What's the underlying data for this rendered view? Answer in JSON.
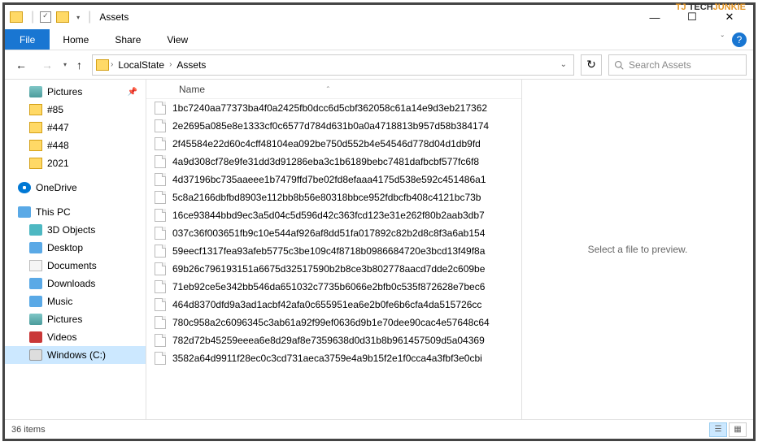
{
  "watermark": {
    "tj": "TJ",
    "tech": "TECH",
    "junkie": "JUNKIE"
  },
  "titlebar": {
    "title": "Assets"
  },
  "menubar": {
    "file": "File",
    "home": "Home",
    "share": "Share",
    "view": "View"
  },
  "breadcrumb": {
    "item1": "LocalState",
    "item2": "Assets"
  },
  "search": {
    "placeholder": "Search Assets"
  },
  "sidebar": {
    "pictures": "Pictures",
    "f85": "#85",
    "f447": "#447",
    "f448": "#448",
    "f2021": "2021",
    "onedrive": "OneDrive",
    "thispc": "This PC",
    "objects3d": "3D Objects",
    "desktop": "Desktop",
    "documents": "Documents",
    "downloads": "Downloads",
    "music": "Music",
    "picslib": "Pictures",
    "videos": "Videos",
    "windowsc": "Windows (C:)"
  },
  "columns": {
    "name": "Name"
  },
  "files": {
    "f0": "1bc7240aa77373ba4f0a2425fb0dcc6d5cbf362058c61a14e9d3eb217362",
    "f1": "2e2695a085e8e1333cf0c6577d784d631b0a0a4718813b957d58b384174",
    "f2": "2f45584e22d60c4cff48104ea092be750d552b4e54546d778d04d1db9fd",
    "f3": "4a9d308cf78e9fe31dd3d91286eba3c1b6189bebc7481dafbcbf577fc6f8",
    "f4": "4d37196bc735aaeee1b7479ffd7be02fd8efaaa4175d538e592c451486a1",
    "f5": "5c8a2166dbfbd8903e112bb8b56e80318bbce952fdbcfb408c4121bc73b",
    "f6": "16ce93844bbd9ec3a5d04c5d596d42c363fcd123e31e262f80b2aab3db7",
    "f7": "037c36f003651fb9c10e544af926af8dd51fa017892c82b2d8c8f3a6ab154",
    "f8": "59eecf1317fea93afeb5775c3be109c4f8718b0986684720e3bcd13f49f8a",
    "f9": "69b26c796193151a6675d32517590b2b8ce3b802778aacd7dde2c609be",
    "f10": "71eb92ce5e342bb546da651032c7735b6066e2bfb0c535f872628e7bec6",
    "f11": "464d8370dfd9a3ad1acbf42afa0c655951ea6e2b0fe6b6cfa4da515726cc",
    "f12": "780c958a2c6096345c3ab61a92f99ef0636d9b1e70dee90cac4e57648c64",
    "f13": "782d72b45259eeea6e8d29af8e7359638d0d31b8b961457509d5a04369",
    "f14": "3582a64d9911f28ec0c3cd731aeca3759e4a9b15f2e1f0cca4a3fbf3e0cbi"
  },
  "preview": {
    "text": "Select a file to preview."
  },
  "statusbar": {
    "count": "36 items"
  }
}
